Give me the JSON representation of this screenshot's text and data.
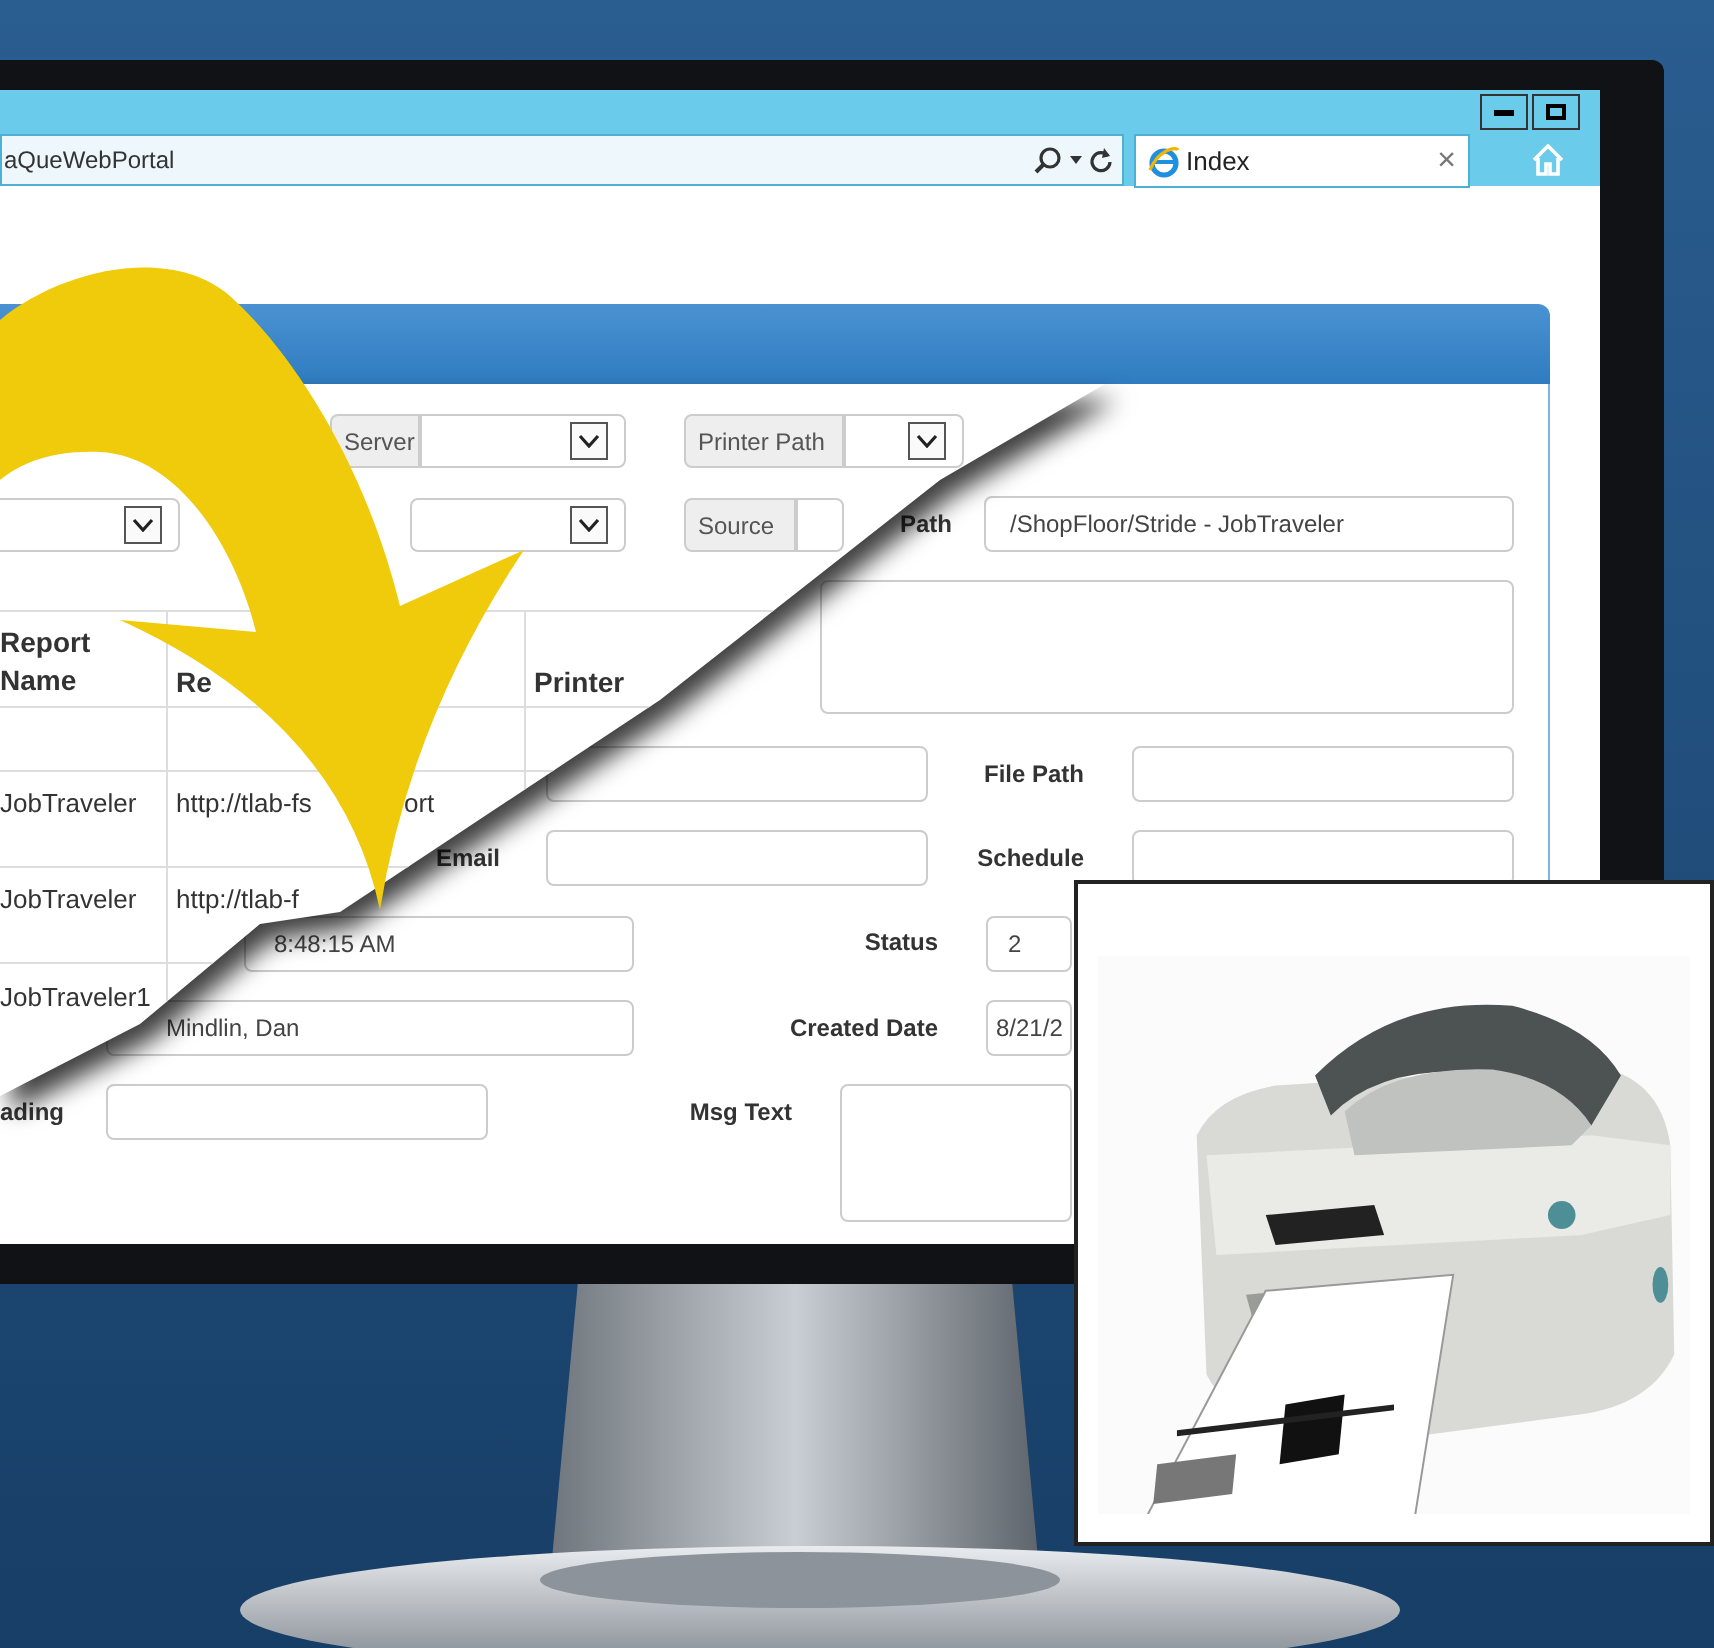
{
  "browser": {
    "address": "aQueWebPortal",
    "tab": {
      "title": "Index",
      "close": "×",
      "selected": true
    }
  },
  "upper_form": {
    "selects": [
      {
        "kind": "addon",
        "label": "Server"
      },
      {
        "kind": "addon",
        "label": "Printer Path"
      },
      {
        "kind": "plain"
      },
      {
        "kind": "plain"
      },
      {
        "kind": "addon",
        "label": "Source"
      }
    ],
    "table": {
      "columns": [
        "Report Name",
        "Re",
        "Printer"
      ],
      "rows": [
        {
          "cells": [
            "JobTraveler",
            "http://tlab-fs"
          ],
          "fragment": "ort"
        },
        {
          "cells": [
            "JobTraveler",
            "http://tlab-f"
          ]
        },
        {
          "cells": [
            "JobTraveler1"
          ]
        }
      ]
    }
  },
  "lower_form": {
    "fields": [
      {
        "kind": "input",
        "label": "Path",
        "value": "/ShopFloor/Stride - JobTraveler"
      },
      {
        "kind": "textarea"
      },
      {
        "kind": "input"
      },
      {
        "kind": "input",
        "label": "File Path"
      },
      {
        "kind": "input",
        "label": "Email"
      },
      {
        "kind": "input",
        "label": "Schedule"
      },
      {
        "kind": "input",
        "value": "8:48:15 AM"
      },
      {
        "kind": "input",
        "label": "Status",
        "value": "2"
      },
      {
        "kind": "input",
        "value": "Mindlin, Dan"
      },
      {
        "kind": "input",
        "label": "Created Date",
        "value": "8/21/2"
      },
      {
        "kind": "input",
        "label": "ading"
      },
      {
        "kind": "textarea",
        "label": "Msg Text"
      }
    ]
  }
}
